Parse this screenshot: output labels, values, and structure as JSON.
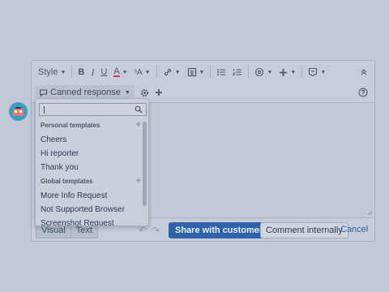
{
  "toolbar": {
    "style_label": "Style",
    "bold": "B",
    "italic": "I",
    "underline": "U",
    "text_color": "A",
    "font_size": "ˢA"
  },
  "toolbar2": {
    "canned_label": "Canned response"
  },
  "dropdown": {
    "search": {
      "value": ""
    },
    "personal": {
      "heading": "Personal templates",
      "items": [
        "Cheers",
        "Hi reporter",
        "Thank you"
      ]
    },
    "global": {
      "heading": "Global templates",
      "items": [
        "More Info Request",
        "Not Supported Browser",
        "Screenshot Request"
      ]
    }
  },
  "footer": {
    "tab_visual": "Visual",
    "tab_text": "Text",
    "share_label": "Share with customer",
    "internal_label": "Comment internally",
    "cancel_label": "Cancel"
  },
  "colors": {
    "background": "#c1c8d6",
    "primary": "#2f62a8",
    "text_color_underline": "#d04437"
  }
}
